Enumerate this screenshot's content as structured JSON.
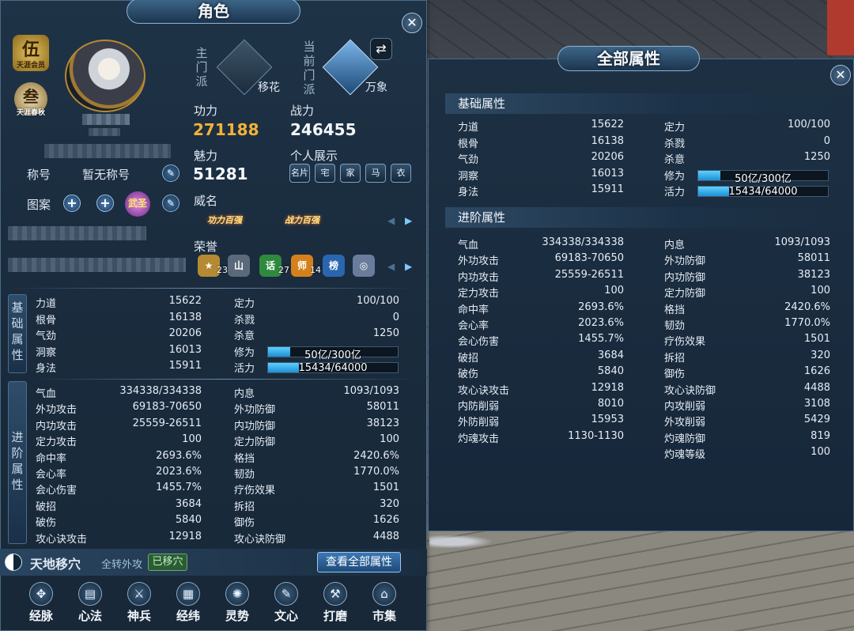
{
  "left_panel": {
    "title": "角色",
    "close": "✕",
    "rank_badge": {
      "glyph": "伍",
      "sub": "天涯会员"
    },
    "rank_badge2": {
      "glyph": "叁",
      "sub": "天涯春秋"
    },
    "sect": {
      "main_label": [
        "主",
        "门",
        "派"
      ],
      "main_name": "移花",
      "current_label": [
        "当",
        "前",
        "门",
        "派"
      ],
      "current_name": "万象"
    },
    "gongli": {
      "label": "功力",
      "value": "271188"
    },
    "zhanli": {
      "label": "战力",
      "value": "246455"
    },
    "meili": {
      "label": "魅力",
      "value": "51281"
    },
    "display": {
      "label": "个人展示",
      "icons": [
        "名片",
        "宅",
        "家",
        "马",
        "衣"
      ]
    },
    "weiming": {
      "label": "威名",
      "badges": [
        "功力百强",
        "战力百强"
      ]
    },
    "title_row": {
      "label": "称号",
      "value": "暂无称号"
    },
    "pattern": {
      "label": "图案",
      "badge": "武圣"
    },
    "honor": {
      "label": "荣誉",
      "icons": [
        {
          "glyph": "★",
          "count": "23",
          "color": "#b58a32"
        },
        {
          "glyph": "山",
          "count": "",
          "color": "#5a6a7a"
        },
        {
          "glyph": "话",
          "count": "27",
          "color": "#2f8a3e"
        },
        {
          "glyph": "师",
          "count": "14",
          "color": "#d4811c"
        },
        {
          "glyph": "榜",
          "count": "",
          "color": "#2a66b0"
        },
        {
          "glyph": "◎",
          "count": "",
          "color": "#6a7c9c"
        }
      ]
    },
    "basic_tab": [
      "基",
      "础",
      "属",
      "性"
    ],
    "advanced_tab": [
      "进",
      "阶",
      "属",
      "性"
    ],
    "basic_stats": [
      {
        "k": "力道",
        "v": "15622",
        "k2": "定力",
        "v2": "100/100"
      },
      {
        "k": "根骨",
        "v": "16138",
        "k2": "杀戮",
        "v2": "0"
      },
      {
        "k": "气劲",
        "v": "20206",
        "k2": "杀意",
        "v2": "1250"
      },
      {
        "k": "洞察",
        "v": "16013",
        "k2": "修为",
        "bar2": "50亿/300亿",
        "fill2": 0.17
      },
      {
        "k": "身法",
        "v": "15911",
        "k2": "活力",
        "bar2": "15434/64000",
        "fill2": 0.24
      }
    ],
    "advanced_stats": [
      {
        "k": "气血",
        "v": "334338/334338",
        "k2": "内息",
        "v2": "1093/1093"
      },
      {
        "k": "外功攻击",
        "v": "69183-70650",
        "k2": "外功防御",
        "v2": "58011"
      },
      {
        "k": "内功攻击",
        "v": "25559-26511",
        "k2": "内功防御",
        "v2": "38123"
      },
      {
        "k": "定力攻击",
        "v": "100",
        "k2": "定力防御",
        "v2": "100"
      },
      {
        "k": "命中率",
        "v": "2693.6%",
        "k2": "格挡",
        "v2": "2420.6%"
      },
      {
        "k": "会心率",
        "v": "2023.6%",
        "k2": "韧劲",
        "v2": "1770.0%"
      },
      {
        "k": "会心伤害",
        "v": "1455.7%",
        "k2": "疗伤效果",
        "v2": "1501"
      },
      {
        "k": "破招",
        "v": "3684",
        "k2": "拆招",
        "v2": "320"
      },
      {
        "k": "破伤",
        "v": "5840",
        "k2": "御伤",
        "v2": "1626"
      },
      {
        "k": "攻心诀攻击",
        "v": "12918",
        "k2": "攻心诀防御",
        "v2": "4488"
      }
    ],
    "bottom": {
      "skill_name": "天地移穴",
      "mode": "全转外攻",
      "moved_btn": "已移穴",
      "view_all_btn": "查看全部属性"
    },
    "nav": [
      {
        "label": "经脉",
        "icon": "✥"
      },
      {
        "label": "心法",
        "icon": "▤"
      },
      {
        "label": "神兵",
        "icon": "⚔"
      },
      {
        "label": "经纬",
        "icon": "▦"
      },
      {
        "label": "灵势",
        "icon": "✺"
      },
      {
        "label": "文心",
        "icon": "✎"
      },
      {
        "label": "打磨",
        "icon": "⚒"
      },
      {
        "label": "市集",
        "icon": "⌂"
      }
    ]
  },
  "right_panel": {
    "title": "全部属性",
    "close": "✕",
    "basic_header": "基础属性",
    "advanced_header": "进阶属性",
    "basic_stats": [
      {
        "k": "力道",
        "v": "15622",
        "k2": "定力",
        "v2": "100/100"
      },
      {
        "k": "根骨",
        "v": "16138",
        "k2": "杀戮",
        "v2": "0"
      },
      {
        "k": "气劲",
        "v": "20206",
        "k2": "杀意",
        "v2": "1250"
      },
      {
        "k": "洞察",
        "v": "16013",
        "k2": "修为",
        "bar2": "50亿/300亿",
        "fill2": 0.17
      },
      {
        "k": "身法",
        "v": "15911",
        "k2": "活力",
        "bar2": "15434/64000",
        "fill2": 0.24
      }
    ],
    "advanced_stats": [
      {
        "k": "气血",
        "v": "334338/334338",
        "k2": "内息",
        "v2": "1093/1093"
      },
      {
        "k": "外功攻击",
        "v": "69183-70650",
        "k2": "外功防御",
        "v2": "58011"
      },
      {
        "k": "内功攻击",
        "v": "25559-26511",
        "k2": "内功防御",
        "v2": "38123"
      },
      {
        "k": "定力攻击",
        "v": "100",
        "k2": "定力防御",
        "v2": "100"
      },
      {
        "k": "命中率",
        "v": "2693.6%",
        "k2": "格挡",
        "v2": "2420.6%"
      },
      {
        "k": "会心率",
        "v": "2023.6%",
        "k2": "韧劲",
        "v2": "1770.0%"
      },
      {
        "k": "会心伤害",
        "v": "1455.7%",
        "k2": "疗伤效果",
        "v2": "1501"
      },
      {
        "k": "破招",
        "v": "3684",
        "k2": "拆招",
        "v2": "320"
      },
      {
        "k": "破伤",
        "v": "5840",
        "k2": "御伤",
        "v2": "1626"
      },
      {
        "k": "攻心诀攻击",
        "v": "12918",
        "k2": "攻心诀防御",
        "v2": "4488"
      },
      {
        "k": "内防削弱",
        "v": "8010",
        "k2": "内攻削弱",
        "v2": "3108"
      },
      {
        "k": "外防削弱",
        "v": "15953",
        "k2": "外攻削弱",
        "v2": "5429"
      },
      {
        "k": "灼魂攻击",
        "v": "1130-1130",
        "k2": "灼魂防御",
        "v2": "819"
      },
      {
        "k": "",
        "v": "",
        "k2": "灼魂等级",
        "v2": "100"
      }
    ]
  },
  "colors": {
    "gold": "#f3b23a",
    "bar": "#3fb8f0",
    "panel": "#1a2c3e"
  }
}
